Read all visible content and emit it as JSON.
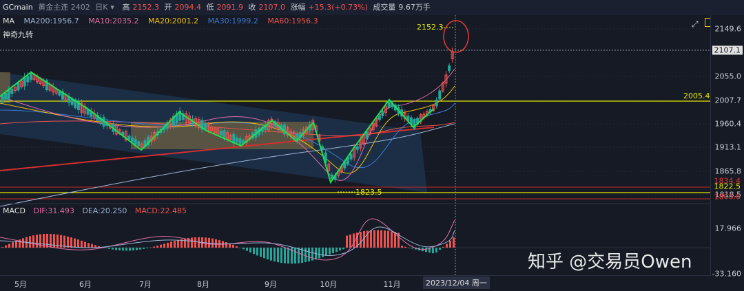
{
  "header": {
    "symbol": "GCmain",
    "name": "黄金主连 2402",
    "period": "日K",
    "high_label": "高",
    "high": "2152.3",
    "open_label": "开",
    "open": "2094.4",
    "low_label": "低",
    "low": "2091.9",
    "close_label": "收",
    "close": "2107.0",
    "change_label": "涨幅",
    "change": "+15.3(+0.73%)",
    "volume_label": "成交量",
    "volume": "9.67万手"
  },
  "ma": {
    "label": "MA",
    "ma200": "MA200:1956.7",
    "ma10": "MA10:2035.2",
    "ma20": "MA20:2001.2",
    "ma30": "MA30:1999.2",
    "ma60": "MA60:1956.3",
    "colors": {
      "ma200": "#9fb4d6",
      "ma10": "#e06fa7",
      "ma20": "#f2c200",
      "ma30": "#3a78d6",
      "ma60": "#ef5350"
    }
  },
  "indicator": {
    "label": "神奇九转"
  },
  "price_axis": {
    "ticks": [
      "2149.6",
      "2055.0",
      "2007.7",
      "1960.4",
      "1913.1",
      "1865.8",
      "1818.5"
    ],
    "current": "2107.1",
    "levels": {
      "high_mark": "2152.3",
      "low_mark": "1823.5",
      "resistance": "2005.4",
      "support_a": "1834.4",
      "support_b": "1822.5",
      "support_c": "1806.6"
    }
  },
  "macd": {
    "label": "MACD",
    "dif": "DIF:31.493",
    "dea": "DEA:20.250",
    "macd": "MACD:22.485",
    "ticks": [
      "17.966",
      "-33.160"
    ]
  },
  "x_axis": {
    "months": [
      "5月",
      "6月",
      "7月",
      "8月",
      "9月",
      "10月",
      "11月"
    ],
    "crosshair_date": "2023/12/04 周一"
  },
  "watermark": "知乎 @交易员Owen"
}
